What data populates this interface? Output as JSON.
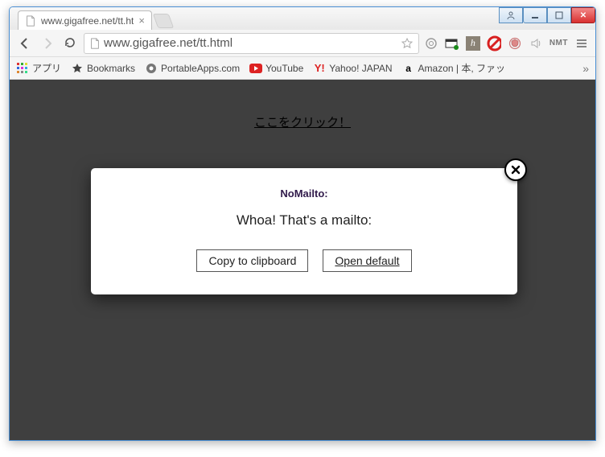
{
  "window": {
    "tab_title": "www.gigafree.net/tt.ht"
  },
  "toolbar": {
    "url": "www.gigafree.net/tt.html",
    "nmt_label": "NMT"
  },
  "bookmarks": {
    "apps": "アプリ",
    "bookmarks": "Bookmarks",
    "portableapps": "PortableApps.com",
    "youtube": "YouTube",
    "yahoo": "Yahoo! JAPAN",
    "amazon": "Amazon | 本, ファッ"
  },
  "page": {
    "link_text": "ここをクリック！"
  },
  "modal": {
    "title": "NoMailto:",
    "message": "Whoa! That's a mailto:",
    "copy_label": "Copy to clipboard",
    "open_label": "Open default"
  }
}
